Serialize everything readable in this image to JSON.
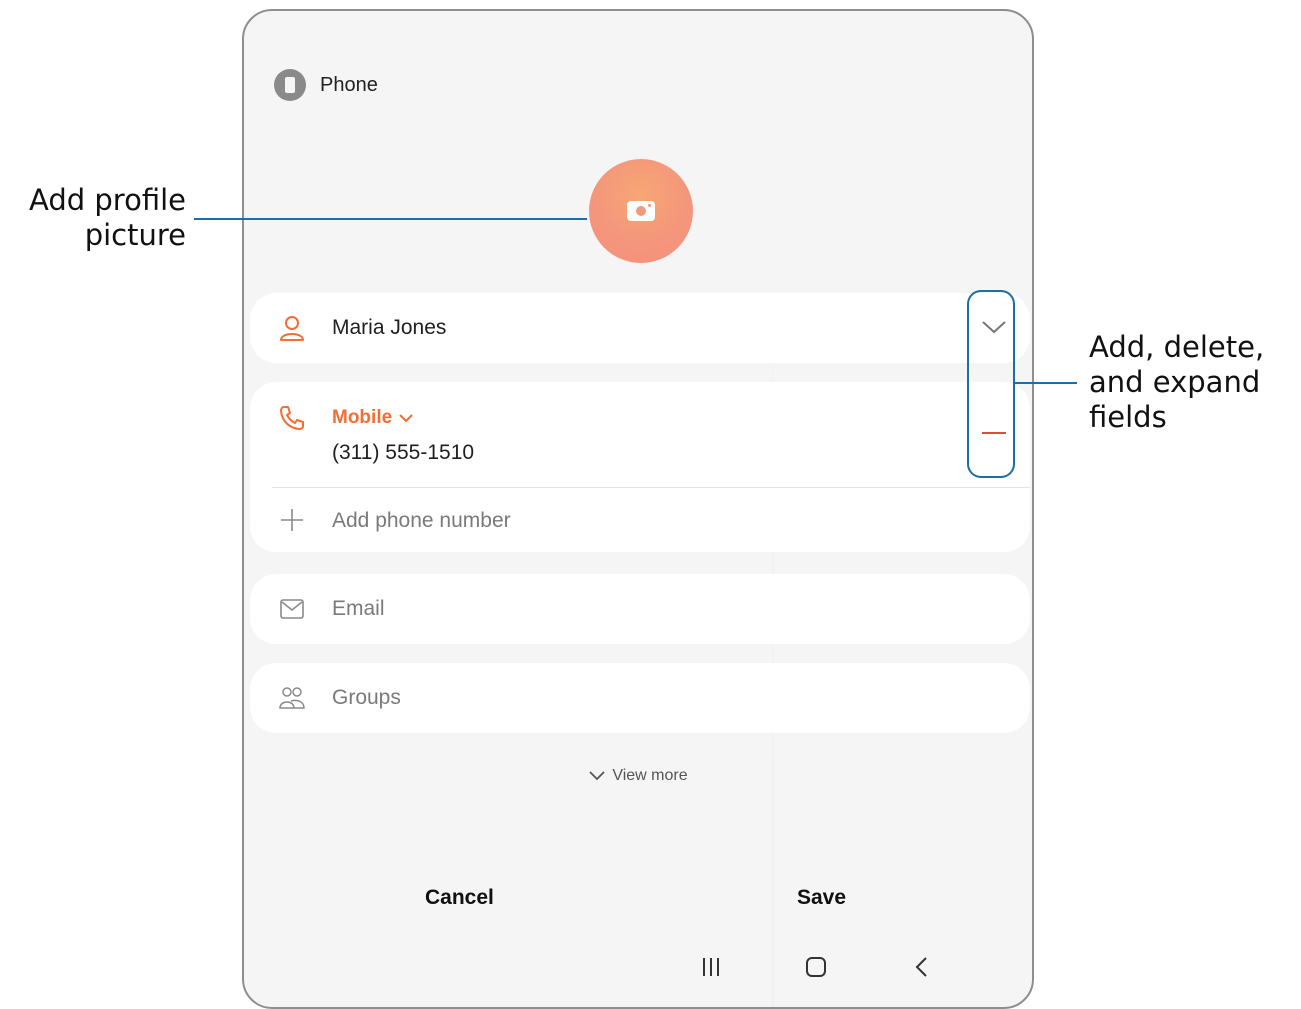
{
  "account": {
    "label": "Phone",
    "icon": "phone-account-icon"
  },
  "profile_picture": {
    "icon": "camera-icon"
  },
  "name_field": {
    "value": "Maria Jones",
    "icon": "person-icon"
  },
  "phone_field": {
    "type_label": "Mobile",
    "value": "(311) 555-1510",
    "icon": "phone-icon"
  },
  "add_phone": {
    "label": "Add phone number",
    "icon": "plus-icon"
  },
  "email_field": {
    "placeholder": "Email",
    "icon": "mail-icon"
  },
  "groups_field": {
    "placeholder": "Groups",
    "icon": "groups-icon"
  },
  "view_more": {
    "label": "View more"
  },
  "actions": {
    "cancel": "Cancel",
    "save": "Save"
  },
  "callouts": {
    "profile_line1": "Add profile",
    "profile_line2": "picture",
    "fields_line1": "Add, delete,",
    "fields_line2": "and expand",
    "fields_line3": "fields"
  },
  "colors": {
    "accent": "#f36e35",
    "annotation": "#1a6fa8",
    "avatar": "#f4967b"
  }
}
